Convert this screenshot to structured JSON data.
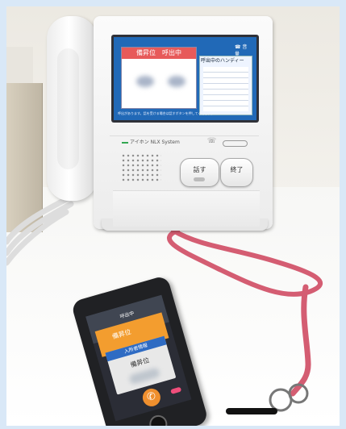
{
  "intercom_screen": {
    "status_title": "備昇位　呼出中",
    "list_title": "呼出中のハンディー",
    "top_labels": "☎ 音 量",
    "bottom_text": "呼出があります。話を受ける場合は話すボタンを押してください。"
  },
  "intercom_panel": {
    "brand": "アイホン NLX System",
    "talk_label": "話す",
    "end_label": "終了"
  },
  "phone_screen": {
    "header": "呼出中",
    "top_card": "備昇位",
    "notice": "入所者情報",
    "name": "備昇位"
  },
  "colors": {
    "lanyard": "#d45d72",
    "call_button": "#ef8f2e",
    "accent_blue": "#2169b7"
  }
}
